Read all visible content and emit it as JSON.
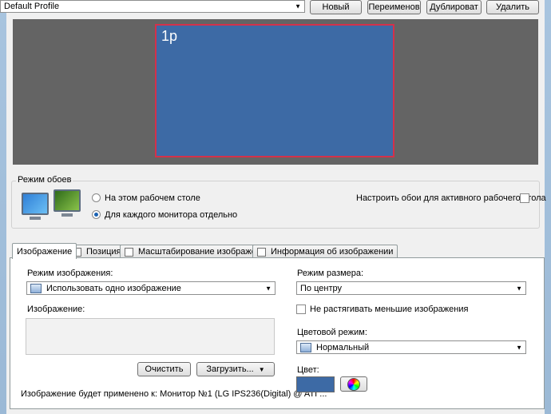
{
  "toolbar": {
    "profile_value": "Default Profile",
    "new_label": "Новый",
    "rename_label": "Переименов",
    "duplicate_label": "Дублироват",
    "delete_label": "Удалить"
  },
  "preview": {
    "monitor_label": "1р"
  },
  "wallpaper_mode": {
    "legend": "Режим обоев",
    "option_same": "На этом рабочем столе",
    "option_each": "Для каждого монитора отдельно",
    "selected": "option_each",
    "active_desktop_label": "Настроить обои для активного рабочего стола",
    "active_desktop_checked": false
  },
  "tabs": [
    {
      "label": "Изображение",
      "active": true
    },
    {
      "label": "Позиция",
      "active": false
    },
    {
      "label": "Масштабирование изображения",
      "active": false
    },
    {
      "label": "Информация об изображении",
      "active": false
    }
  ],
  "image_tab": {
    "image_mode_label": "Режим изображения:",
    "image_mode_value": "Использовать одно изображение",
    "image_label": "Изображение:",
    "clear_label": "Очистить",
    "load_label": "Загрузить...",
    "applied_text": "Изображение будет применено к: Монитор №1 (LG IPS236(Digital) @ ATI ...",
    "size_mode_label": "Режим размера:",
    "size_mode_value": "По центру",
    "no_stretch_label": "Не растягивать меньшие изображения",
    "no_stretch_checked": false,
    "color_mode_label": "Цветовой режим:",
    "color_mode_value": "Нормальный",
    "color_label": "Цвет:",
    "color_value": "#3d6aa5"
  },
  "colors": {
    "preview_bg": "#646464",
    "monitor_fill": "#3d6aa5",
    "monitor_border": "#d4314a"
  }
}
